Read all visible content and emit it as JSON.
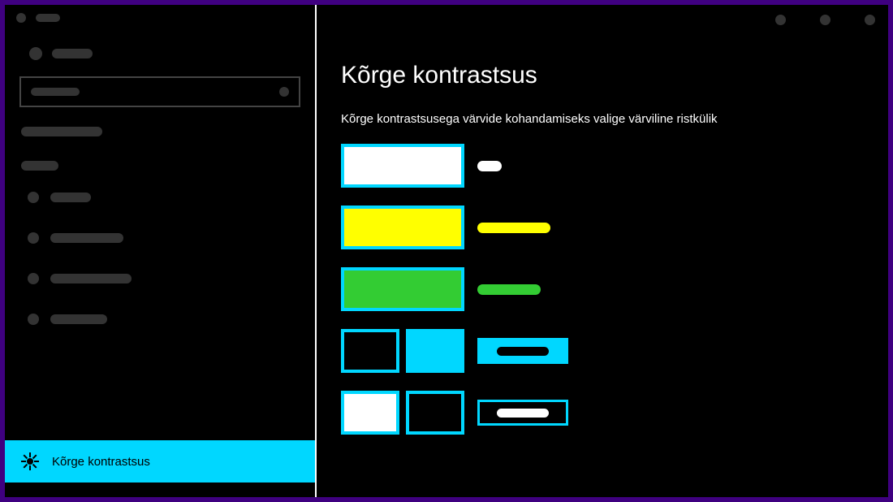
{
  "sidebar": {
    "selected_label": "Kõrge kontrastsus"
  },
  "main": {
    "title": "Kõrge kontrastsus",
    "subtitle": "Kõrge kontrastsusega värvide kohandamiseks valige värviline ristkülik",
    "swatches": [
      {
        "fill": "#ffffff",
        "border": "#00d7ff"
      },
      {
        "fill": "#ffff00",
        "border": "#00d7ff"
      },
      {
        "fill": "#33cc33",
        "border": "#00d7ff"
      }
    ],
    "selected_text_pair": {
      "left": "#000000",
      "right": "#00d7ff",
      "border": "#00d7ff"
    },
    "button_pair": {
      "left": "#ffffff",
      "right": "#000000",
      "border": "#00d7ff"
    },
    "accent": "#00d7ff"
  }
}
